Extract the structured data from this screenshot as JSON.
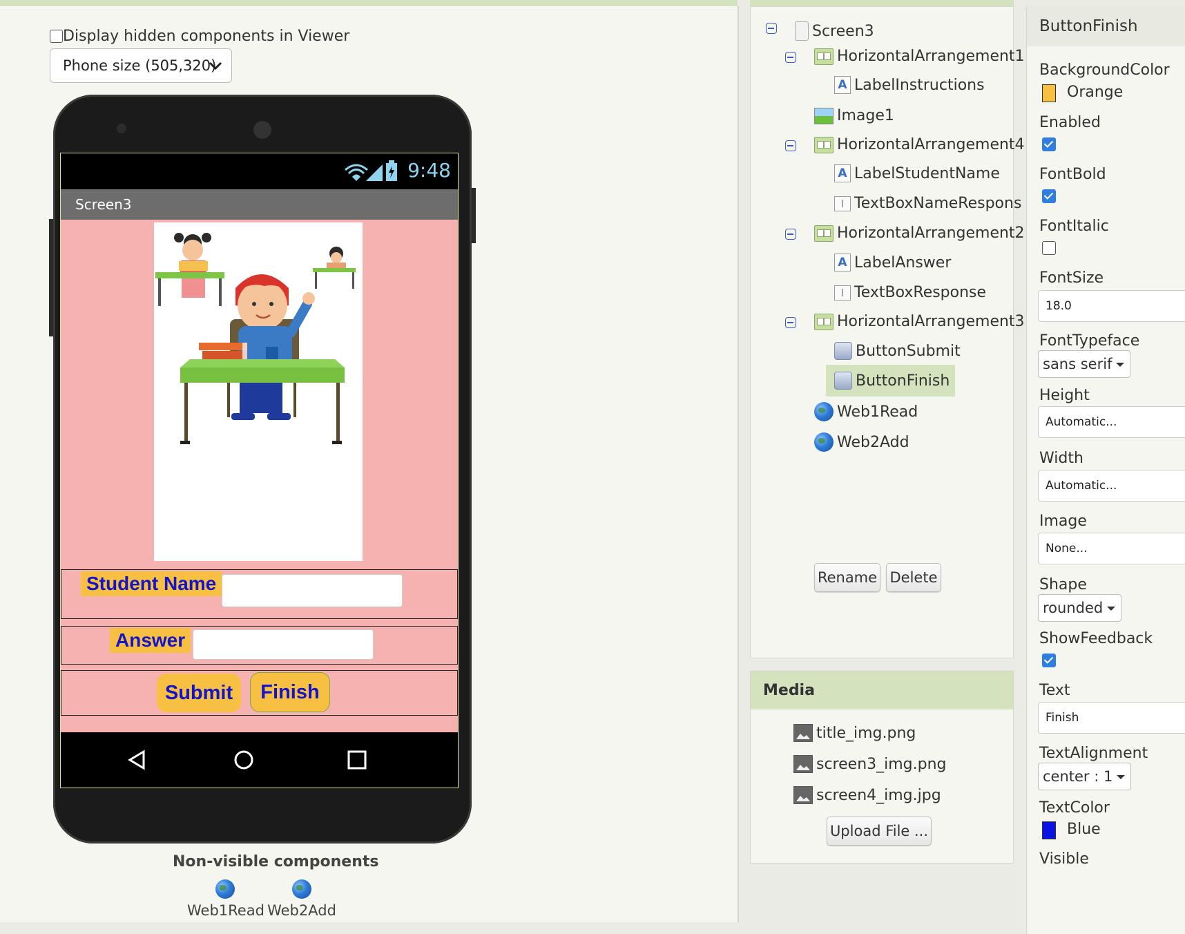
{
  "viewer": {
    "hidden_components_label": "Display hidden components in Viewer",
    "phone_size": "Phone size (505,320)",
    "phone": {
      "time": "9:48",
      "screen_title": "Screen3",
      "student_name_label": "Student Name",
      "answer_label": "Answer",
      "submit_label": "Submit",
      "finish_label": "Finish"
    },
    "non_visible_title": "Non-visible components",
    "non_visible": [
      "Web1Read",
      "Web2Add"
    ]
  },
  "tree": {
    "items": [
      {
        "label": "Screen3",
        "icon": "screen-icon",
        "collapsible": true
      },
      {
        "label": "HorizontalArrangement1",
        "icon": "horizontal-arrangement-icon",
        "collapsible": true
      },
      {
        "label": "LabelInstructions",
        "icon": "label-icon"
      },
      {
        "label": "Image1",
        "icon": "image-icon"
      },
      {
        "label": "HorizontalArrangement4",
        "icon": "horizontal-arrangement-icon",
        "collapsible": true
      },
      {
        "label": "LabelStudentName",
        "icon": "label-icon"
      },
      {
        "label": "TextBoxNameRespons",
        "icon": "textbox-icon"
      },
      {
        "label": "HorizontalArrangement2",
        "icon": "horizontal-arrangement-icon",
        "collapsible": true
      },
      {
        "label": "LabelAnswer",
        "icon": "label-icon"
      },
      {
        "label": "TextBoxResponse",
        "icon": "textbox-icon"
      },
      {
        "label": "HorizontalArrangement3",
        "icon": "horizontal-arrangement-icon",
        "collapsible": true
      },
      {
        "label": "ButtonSubmit",
        "icon": "button-icon"
      },
      {
        "label": "ButtonFinish",
        "icon": "button-icon",
        "selected": true
      },
      {
        "label": "Web1Read",
        "icon": "web-globe-icon"
      },
      {
        "label": "Web2Add",
        "icon": "web-globe-icon"
      }
    ],
    "rename_label": "Rename",
    "delete_label": "Delete"
  },
  "media": {
    "title": "Media",
    "files": [
      "title_img.png",
      "screen3_img.png",
      "screen4_img.jpg"
    ],
    "upload_label": "Upload File ..."
  },
  "properties": {
    "component": "ButtonFinish",
    "background_color": {
      "label": "BackgroundColor",
      "value": "Orange",
      "color": "#f7c043"
    },
    "enabled": {
      "label": "Enabled",
      "checked": true
    },
    "font_bold": {
      "label": "FontBold",
      "checked": true
    },
    "font_italic": {
      "label": "FontItalic",
      "checked": false
    },
    "font_size": {
      "label": "FontSize",
      "value": "18.0"
    },
    "font_typeface": {
      "label": "FontTypeface",
      "value": "sans serif"
    },
    "height": {
      "label": "Height",
      "value": "Automatic..."
    },
    "width": {
      "label": "Width",
      "value": "Automatic..."
    },
    "image": {
      "label": "Image",
      "value": "None..."
    },
    "shape": {
      "label": "Shape",
      "value": "rounded"
    },
    "show_feedback": {
      "label": "ShowFeedback",
      "checked": true
    },
    "text": {
      "label": "Text",
      "value": "Finish"
    },
    "text_alignment": {
      "label": "TextAlignment",
      "value": "center : 1"
    },
    "text_color": {
      "label": "TextColor",
      "value": "Blue",
      "color": "#0a14e0"
    },
    "visible": {
      "label": "Visible"
    }
  },
  "colors": {
    "panel_header": "#d4e2bd",
    "phone_bg": "#f5b2b1",
    "button_fill": "#f7c043",
    "button_text": "#1414c8"
  }
}
